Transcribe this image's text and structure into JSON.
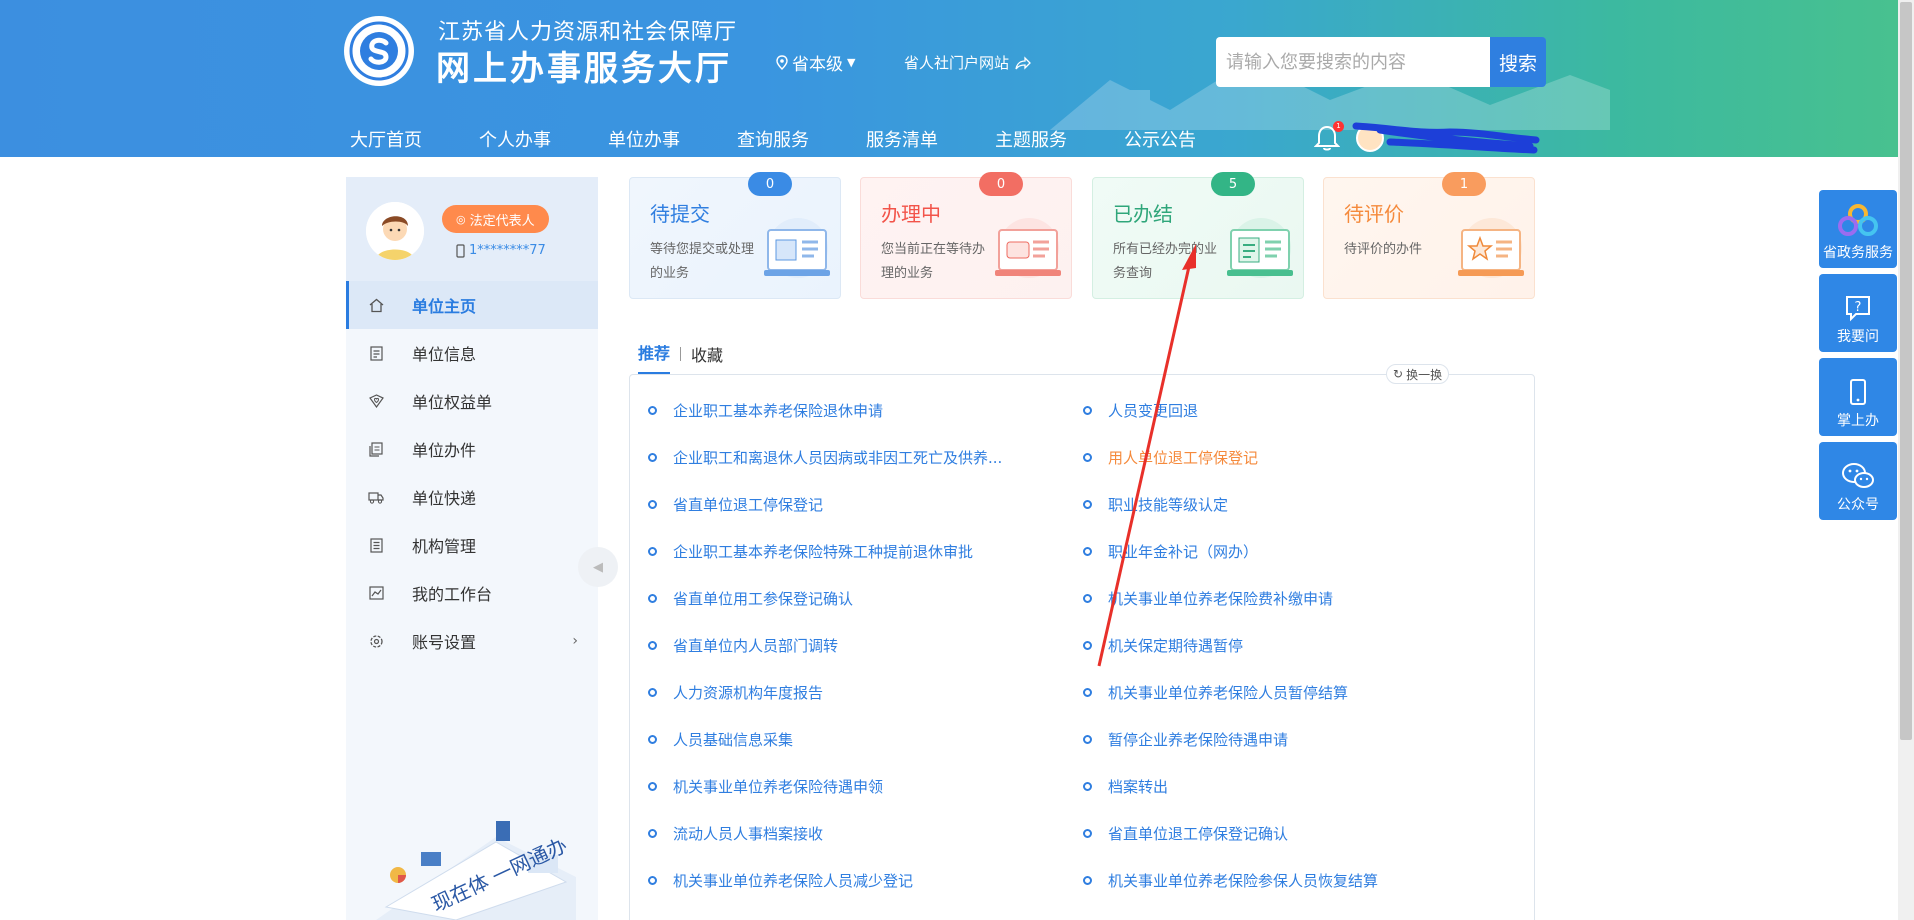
{
  "header": {
    "org_name": "江苏省人力资源和社会保障厅",
    "site_name": "网上办事服务大厅",
    "region": "省本级",
    "portal_link": "省人社门户网站",
    "search_placeholder": "请输入您要搜索的内容",
    "search_button": "搜索",
    "notification_count": "1",
    "nav": [
      "大厅首页",
      "个人办事",
      "单位办事",
      "查询服务",
      "服务清单",
      "主题服务",
      "公示公告"
    ]
  },
  "sidebar": {
    "role_badge": "法定代表人",
    "phone": "1********77",
    "menu": [
      {
        "label": "单位主页",
        "icon": "home-icon"
      },
      {
        "label": "单位信息",
        "icon": "document-icon"
      },
      {
        "label": "单位权益单",
        "icon": "shield-heart-icon"
      },
      {
        "label": "单位办件",
        "icon": "files-icon"
      },
      {
        "label": "单位快递",
        "icon": "truck-icon"
      },
      {
        "label": "机构管理",
        "icon": "list-icon"
      },
      {
        "label": "我的工作台",
        "icon": "chart-icon"
      },
      {
        "label": "账号设置",
        "icon": "gear-icon"
      }
    ],
    "illustration_text": "现在体 一网通办"
  },
  "cards": [
    {
      "title": "待提交",
      "desc": "等待您提交或处理的业务",
      "count": "0"
    },
    {
      "title": "办理中",
      "desc": "您当前正在等待办理的业务",
      "count": "0"
    },
    {
      "title": "已办结",
      "desc": "所有已经办完的业务查询",
      "count": "5"
    },
    {
      "title": "待评价",
      "desc": "待评价的办件",
      "count": "1"
    }
  ],
  "tabs": {
    "recommend": "推荐",
    "favorites": "收藏",
    "refresh": "换一换"
  },
  "services_left": [
    "企业职工基本养老保险退休申请",
    "企业职工和离退休人员因病或非因工死亡及供养...",
    "省直单位退工停保登记",
    "企业职工基本养老保险特殊工种提前退休审批",
    "省直单位用工参保登记确认",
    "省直单位内人员部门调转",
    "人力资源机构年度报告",
    "人员基础信息采集",
    "机关事业单位养老保险待遇申领",
    "流动人员人事档案接收",
    "机关事业单位养老保险人员减少登记"
  ],
  "services_right": [
    "人员变更回退",
    "用人单位退工停保登记",
    "职业技能等级认定",
    "职业年金补记（网办）",
    "机关事业单位养老保险费补缴申请",
    "机关保定期待遇暂停",
    "机关事业单位养老保险人员暂停结算",
    "暂停企业养老保险待遇申请",
    "档案转出",
    "省直单位退工停保登记确认",
    "机关事业单位养老保险参保人员恢复结算"
  ],
  "float_buttons": [
    "省政务服务",
    "我要问",
    "掌上办",
    "公众号"
  ],
  "colors": {
    "primary": "#2f7ee0",
    "highlight": "#f58a3c",
    "annotation": "#e8302a"
  }
}
